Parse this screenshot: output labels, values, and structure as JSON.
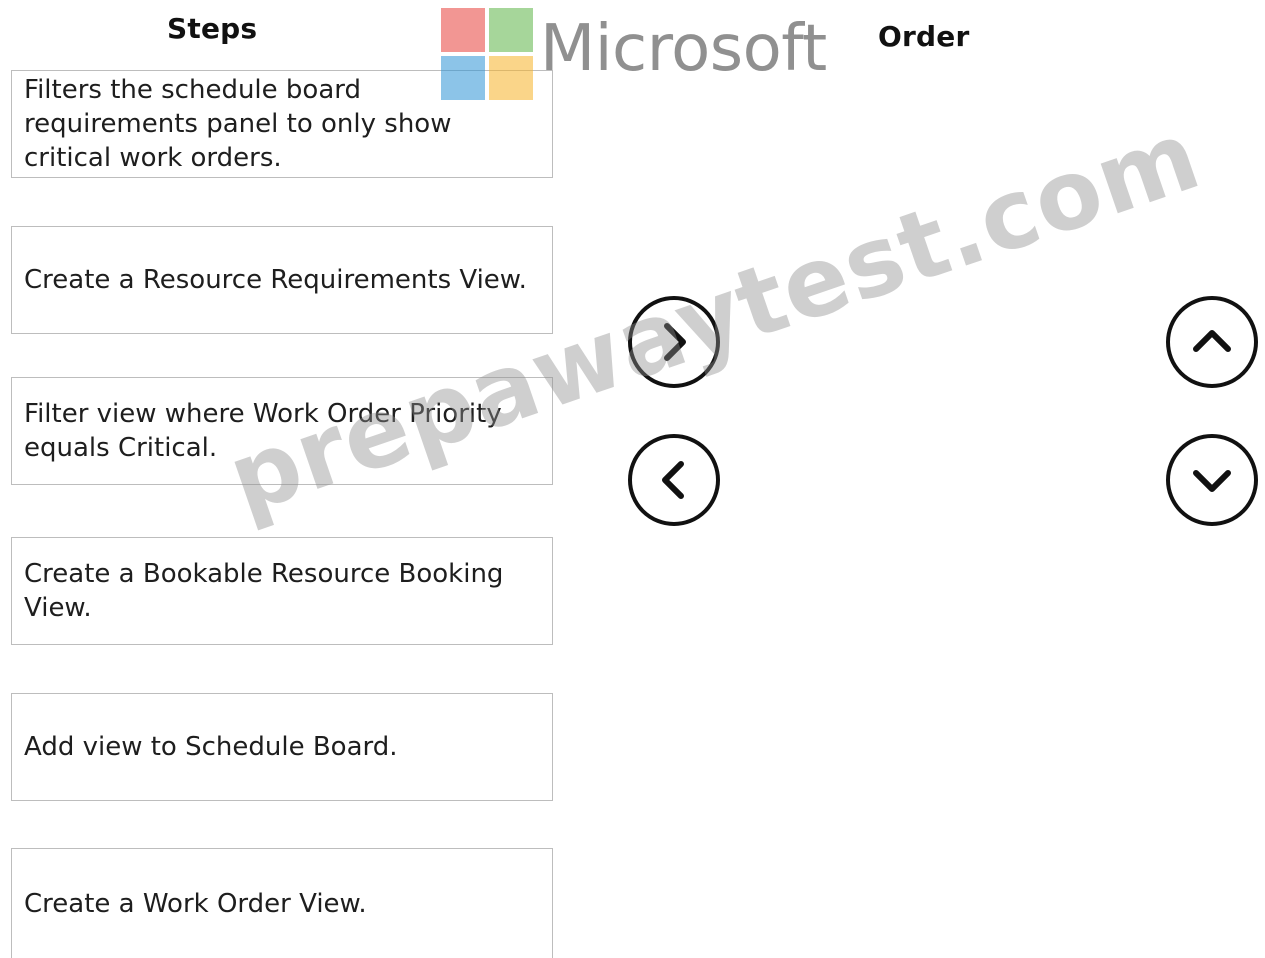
{
  "headings": {
    "steps": "Steps",
    "order": "Order"
  },
  "steps": [
    "Filters the schedule board requirements panel to only show critical work orders.",
    "Create a Resource Requirements View.",
    "Filter view where Work Order Priority equals Critical.",
    "Create a Bookable Resource Booking View.",
    "Add view to Schedule Board.",
    "Create a Work Order View."
  ],
  "controls": {
    "move_right_icon": "chevron-right-icon",
    "move_left_icon": "chevron-left-icon",
    "move_up_icon": "chevron-up-icon",
    "move_down_icon": "chevron-down-icon"
  },
  "branding": {
    "logo_wordmark": "Microsoft",
    "logo_colors": [
      "#e8413b",
      "#5fb548",
      "#2f94d6",
      "#f6b32a"
    ],
    "watermark": "prepawaytest.com"
  }
}
